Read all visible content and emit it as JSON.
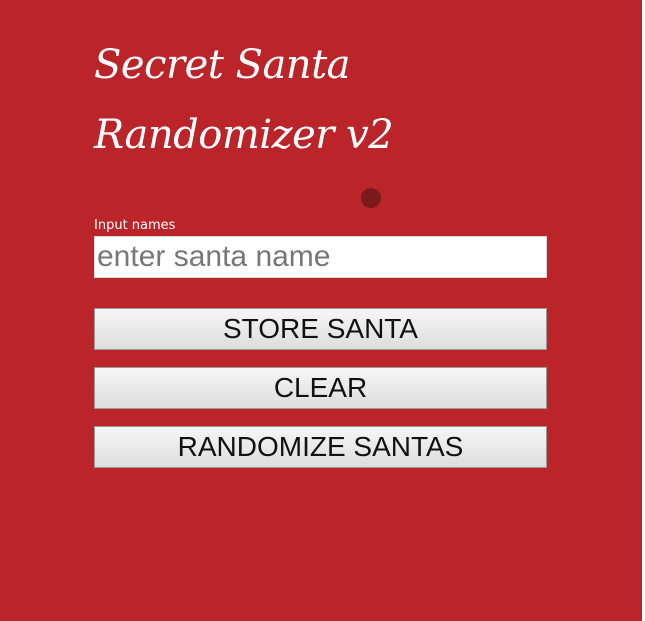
{
  "header": {
    "title": "Secret Santa Randomizer v2"
  },
  "form": {
    "label": "Input names",
    "name_input": {
      "value": "",
      "placeholder": "enter santa name"
    }
  },
  "buttons": {
    "store_label": "STORE SANTA",
    "clear_label": "CLEAR",
    "randomize_label": "RANDOMIZE SANTAS"
  },
  "colors": {
    "background": "#bb2429",
    "indicator": "#7a1a1c",
    "title_text": "#ffffff"
  }
}
